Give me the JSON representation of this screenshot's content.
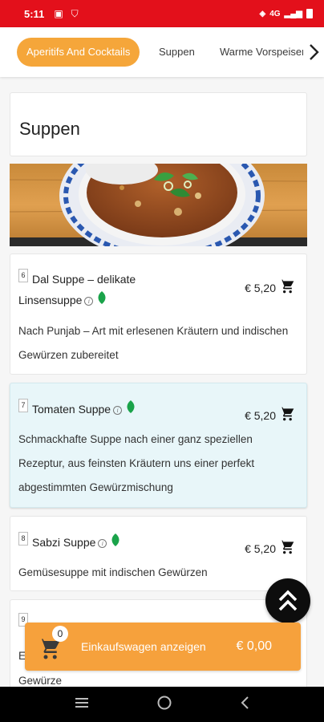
{
  "status_bar": {
    "time": "5:11",
    "network": "4G"
  },
  "tabs": [
    {
      "label": "Aperitifs And Cocktails",
      "active": true
    },
    {
      "label": "Suppen",
      "active": false
    },
    {
      "label": "Warme Vorspeisen",
      "active": false
    }
  ],
  "section": {
    "title": "Suppen"
  },
  "items": [
    {
      "number": "6",
      "title_line1": "Dal Suppe – delikate",
      "title_line2": "Linsensuppe",
      "price": "€ 5,20",
      "description_line1": "Nach Punjab – Art mit erlesenen Kräutern und indischen",
      "description_line2": "Gewürzen zubereitet"
    },
    {
      "number": "7",
      "title": "Tomaten Suppe",
      "price": "€ 5,20",
      "description_line1": "Schmackhafte Suppe nach einer ganz speziellen",
      "description_line2": "Rezeptur, aus feinsten Kräutern uns einer perfekt",
      "description_line3": "abgestimmten Gewürzmischung"
    },
    {
      "number": "8",
      "title": "Sabzi Suppe",
      "price": "€ 5,20",
      "description_line1": "Gemüsesuppe mit indischen Gewürzen"
    },
    {
      "number": "9",
      "partial_line1": "E",
      "partial_line2": "Gewürze"
    }
  ],
  "cart": {
    "count": "0",
    "label": "Einkaufswagen anzeigen",
    "total": "€ 0,00"
  },
  "colors": {
    "status_bar": "#e3101b",
    "accent_orange": "#f5a63a",
    "leaf_green": "#1aa34a",
    "highlight_card": "#e8f6f9"
  },
  "icons": {
    "cart": "cart-icon",
    "info": "info-icon",
    "vegetarian": "leaf-icon",
    "scroll_top": "double-chevron-up-icon"
  }
}
